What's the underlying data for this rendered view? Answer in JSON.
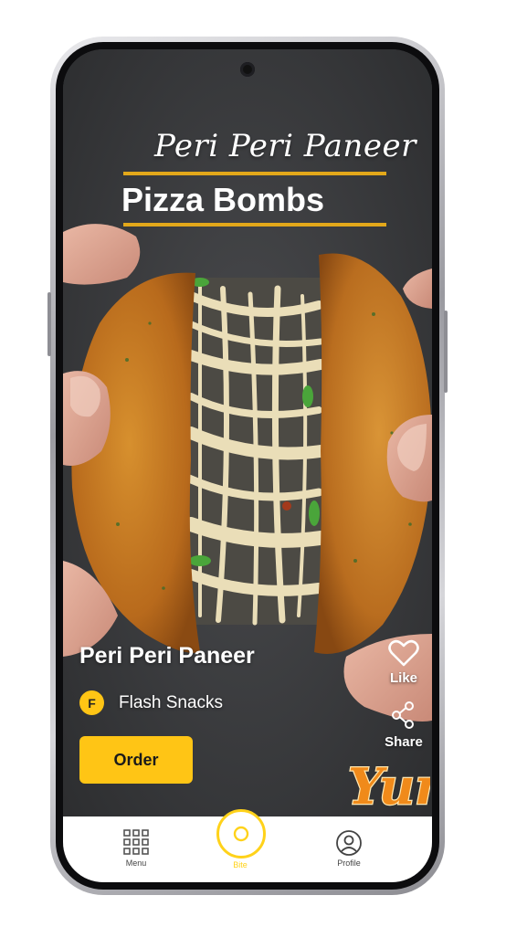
{
  "video": {
    "title_script": "Peri Peri Paneer",
    "title_bold": "Pizza Bombs",
    "watermark": "Yum"
  },
  "item": {
    "name": "Peri Peri Paneer",
    "store_initial": "F",
    "store_name": "Flash Snacks",
    "order_label": "Order"
  },
  "actions": {
    "like_label": "Like",
    "share_label": "Share"
  },
  "nav": {
    "menu_label": "Menu",
    "center_label": "Bite",
    "profile_label": "Profile"
  },
  "colors": {
    "accent": "#ffc515",
    "title_underline": "#e3a81a",
    "screen_bg": "#3c3d3f"
  }
}
